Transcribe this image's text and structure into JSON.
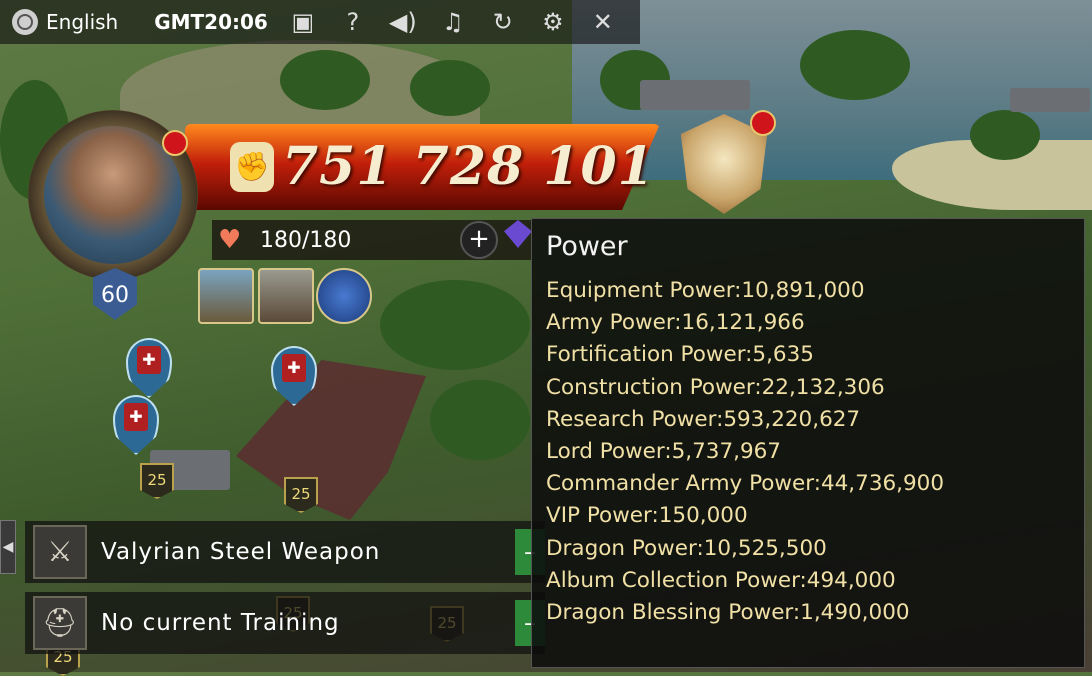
{
  "topbar": {
    "language": "English",
    "time": "GMT20:06",
    "icons": [
      "screenshot-icon",
      "help-icon",
      "sound-icon",
      "music-icon",
      "refresh-icon",
      "settings-icon",
      "collapse-icon"
    ]
  },
  "player": {
    "power": "751 728 101",
    "stamina": "180/180",
    "level": "60"
  },
  "map_levels": [
    "25",
    "25",
    "25",
    "25",
    "25"
  ],
  "queues": [
    {
      "label": "Valyrian Steel Weapon"
    },
    {
      "label": "No current Training"
    }
  ],
  "power_tooltip": {
    "title": "Power",
    "items": [
      "Equipment Power:10,891,000",
      "Army Power:16,121,966",
      "Fortification Power:5,635",
      "Construction Power:22,132,306",
      "Research Power:593,220,627",
      "Lord Power:5,737,967",
      "Commander Army Power:44,736,900",
      "VIP Power:150,000",
      "Dragon Power:10,525,500",
      "Album Collection Power:494,000",
      "Dragon Blessing Power:1,490,000"
    ]
  },
  "colors": {
    "power_bar": "#c3200a",
    "tooltip_text": "#f0e0a6",
    "notification": "#d0141b"
  }
}
